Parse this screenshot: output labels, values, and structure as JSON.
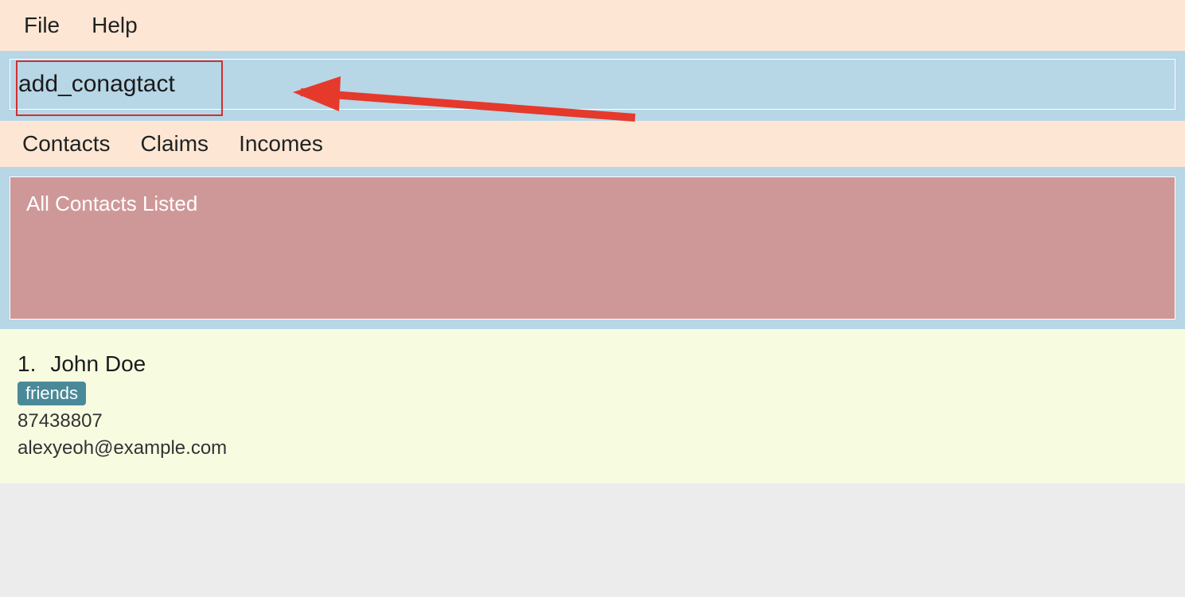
{
  "menubar": {
    "file": "File",
    "help": "Help"
  },
  "command": {
    "value": "add_conagtact"
  },
  "tabs": {
    "contacts": "Contacts",
    "claims": "Claims",
    "incomes": "Incomes"
  },
  "status": {
    "message": "All Contacts Listed"
  },
  "contacts": [
    {
      "index": "1.",
      "name": "John Doe",
      "tag": "friends",
      "phone": "87438807",
      "email": "alexyeoh@example.com"
    }
  ],
  "annotation": {
    "highlight_color": "#d32f2f",
    "arrow_color": "#e5392c"
  }
}
